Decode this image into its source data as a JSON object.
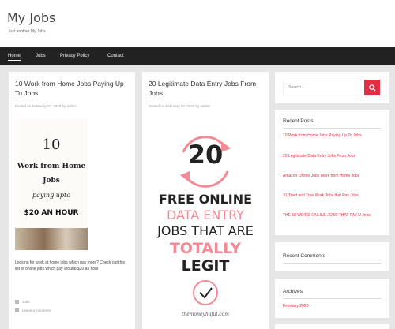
{
  "header": {
    "site_title": "My Jobs",
    "site_description": "Just another My Jobs"
  },
  "nav": {
    "items": [
      {
        "label": "Home",
        "active": true
      },
      {
        "label": "Jobs"
      },
      {
        "label": "Privacy Policy"
      },
      {
        "label": "Contact"
      }
    ]
  },
  "posts": [
    {
      "title": "10 Work from Home Jobs Paying Up To Jobs",
      "meta": "Posted on February 10, 2020 by admin",
      "image_lines": [
        "10",
        "Work from Home",
        "Jobs",
        "paying upto",
        "$20 AN HOUR"
      ],
      "excerpt": "Looking for work at home jobs which pay more? Check out this list of online jobs which pay around $20 an hour",
      "category": "Jobs",
      "comment_link": "Leave a comment"
    },
    {
      "title": "20 Legitimate Data Entry Jobs From Jobs",
      "meta": "Posted on February 10, 2020 by admin",
      "image_lines": [
        "20",
        "FREE ONLINE",
        "DATA ENTRY",
        "JOBS THAT ARE",
        "TOTALLY",
        "LEGIT",
        "themoneyhaful.com"
      ]
    }
  ],
  "sidebar": {
    "search_placeholder": "Search ...",
    "recent_posts_title": "Recent Posts",
    "recent_posts": [
      "10 Work from Home Jobs Paying Up To Jobs",
      "20 Legitimate Data Entry Jobs From Jobs",
      "Amazon Online Jobs Work from Home Jobs",
      "31 Tried and True Work Jobs that Pay Jobs",
      "THE 10 WEIRD ONLINE JOBS THAT PAY U Jobs"
    ],
    "recent_comments_title": "Recent Comments",
    "archives_title": "Archives",
    "archives": [
      "February 2020"
    ]
  },
  "colors": {
    "accent": "#e22d43",
    "nav_bg": "#222222",
    "page_bg": "#e6e6e6"
  }
}
